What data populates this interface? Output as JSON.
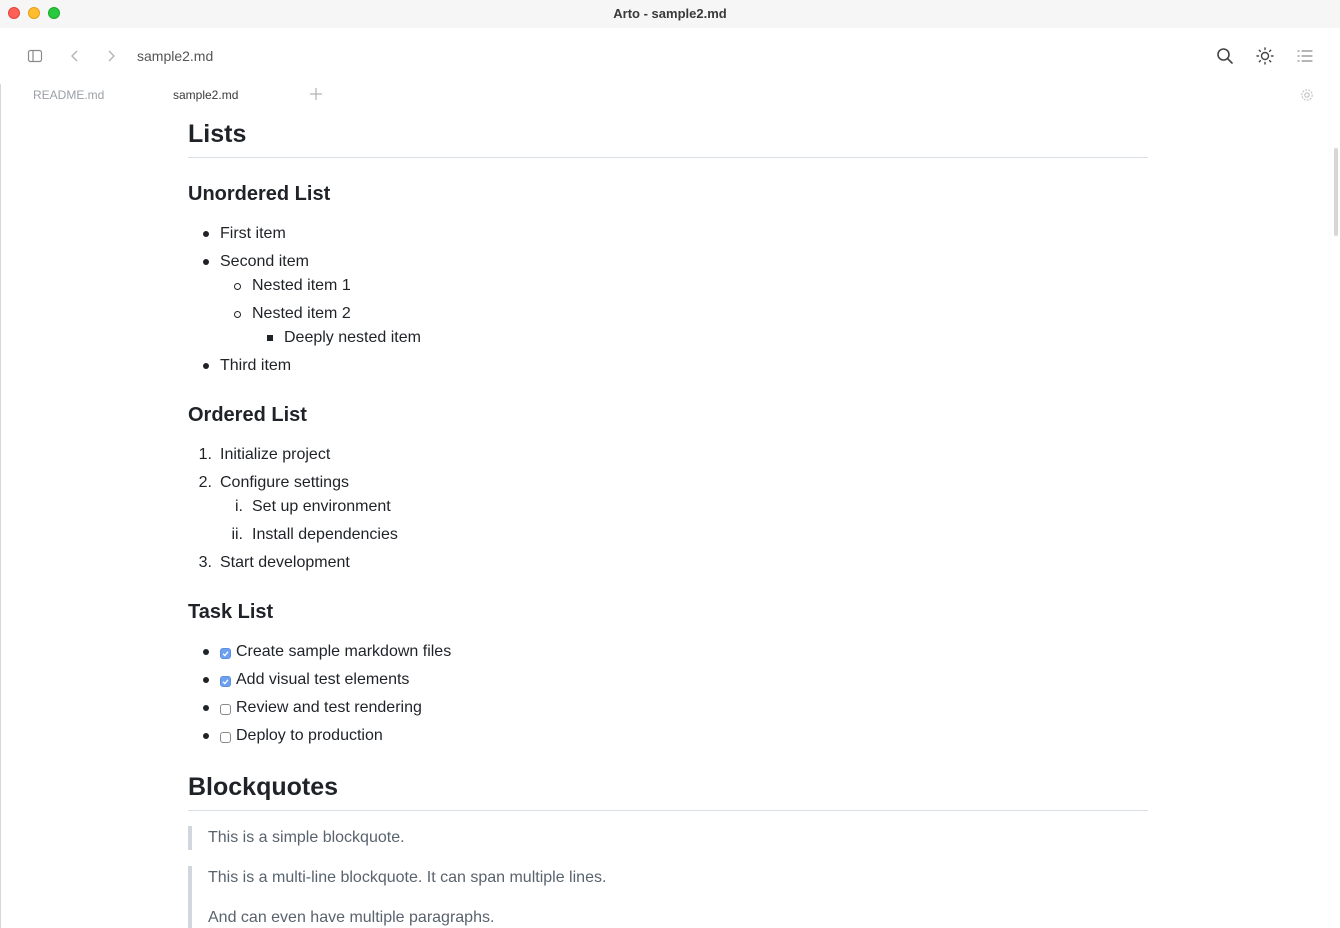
{
  "window": {
    "title": "Arto - sample2.md"
  },
  "toolbar": {
    "document_name": "sample2.md",
    "icons": [
      "sidebar-toggle-icon",
      "back-arrow-icon",
      "forward-arrow-icon",
      "search-icon",
      "theme-sun-icon",
      "outline-list-icon"
    ]
  },
  "tabs": [
    {
      "label": "README.md",
      "active": false
    },
    {
      "label": "sample2.md",
      "active": true
    }
  ],
  "content": {
    "lists_heading": "Lists",
    "unordered": {
      "heading": "Unordered List",
      "items": [
        "First item",
        "Second item",
        "Nested item 1",
        "Nested item 2",
        "Deeply nested item",
        "Third item"
      ]
    },
    "ordered": {
      "heading": "Ordered List",
      "markers": [
        "1.",
        "2.",
        "i.",
        "ii.",
        "3."
      ],
      "items": [
        "Initialize project",
        "Configure settings",
        "Set up environment",
        "Install dependencies",
        "Start development"
      ]
    },
    "tasks": {
      "heading": "Task List",
      "items": [
        {
          "label": "Create sample markdown files",
          "checked": true
        },
        {
          "label": "Add visual test elements",
          "checked": true
        },
        {
          "label": "Review and test rendering",
          "checked": false
        },
        {
          "label": "Deploy to production",
          "checked": false
        }
      ]
    },
    "blockquotes": {
      "heading": "Blockquotes",
      "quote1": "This is a simple blockquote.",
      "quote2_p1": "This is a multi-line blockquote. It can span multiple lines.",
      "quote2_p2": "And can even have multiple paragraphs."
    }
  },
  "colors": {
    "checkbox_checked": "#6ea0f0",
    "blockquote_text": "#59636e"
  }
}
